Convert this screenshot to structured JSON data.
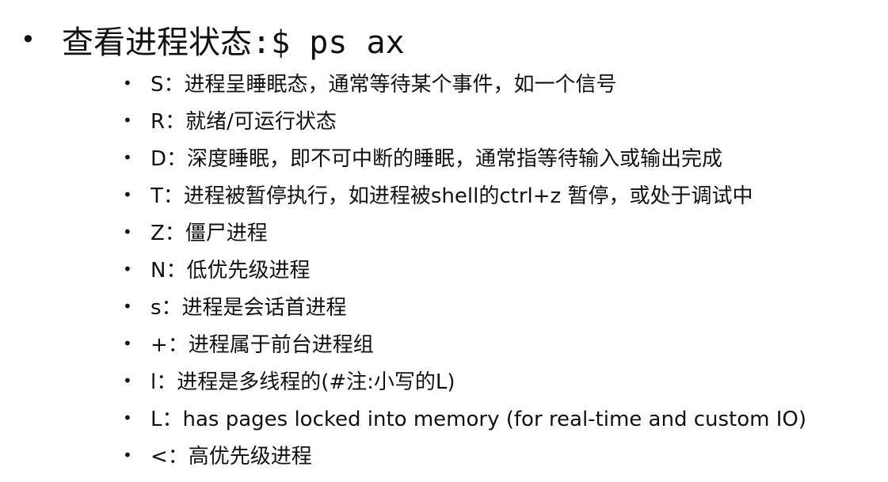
{
  "slide": {
    "heading": {
      "bullet": "•",
      "text": "查看进程状态:$ ps ax"
    },
    "item_bullet": "•",
    "items": [
      {
        "text": "S：进程呈睡眠态，通常等待某个事件，如一个信号"
      },
      {
        "text": "R：就绪/可运行状态"
      },
      {
        "text": "D：深度睡眠，即不可中断的睡眠，通常指等待输入或输出完成"
      },
      {
        "text": "T：进程被暂停执行，如进程被shell的ctrl+z 暂停，或处于调试中"
      },
      {
        "text": "Z：僵尸进程"
      },
      {
        "text": "N：低优先级进程"
      },
      {
        "text": "s：进程是会话首进程"
      },
      {
        "text": "+：进程属于前台进程组"
      },
      {
        "text": "l：进程是多线程的(#注:小写的L)"
      },
      {
        "text": "L：has pages locked into memory (for real-time and custom IO)"
      },
      {
        "text": "<：高优先级进程"
      }
    ]
  }
}
